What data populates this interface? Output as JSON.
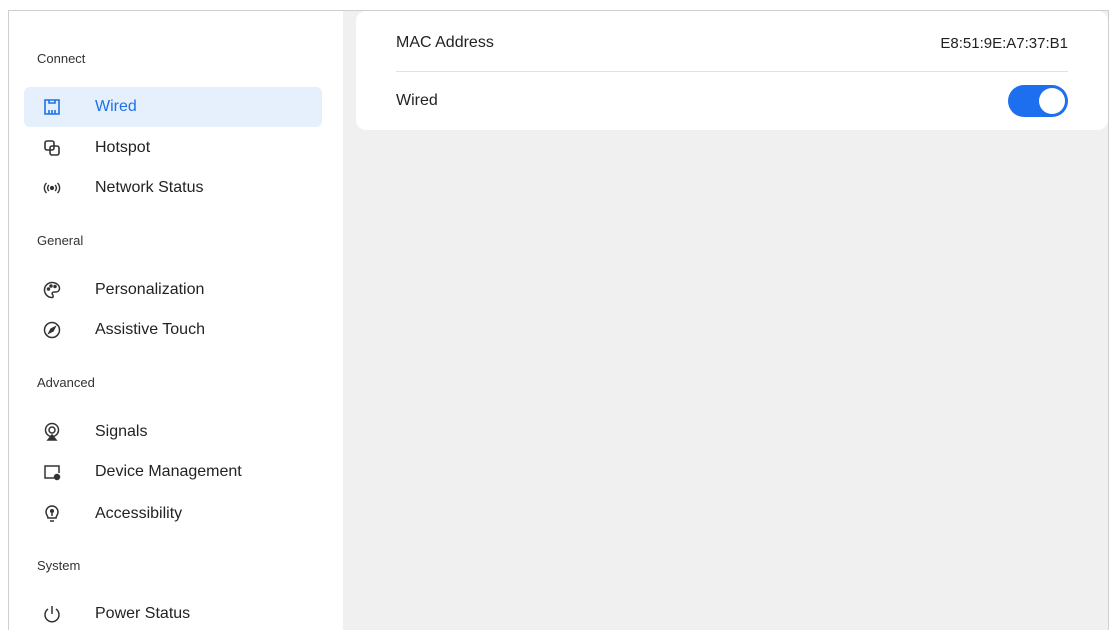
{
  "sidebar": {
    "sections": {
      "connect": "Connect",
      "general": "General",
      "advanced": "Advanced",
      "system": "System"
    },
    "items": [
      {
        "label": "Wired",
        "icon": "ethernet-icon",
        "active": true
      },
      {
        "label": "Hotspot",
        "icon": "hotspot-icon"
      },
      {
        "label": "Network Status",
        "icon": "network-status-icon"
      },
      {
        "label": "Personalization",
        "icon": "palette-icon"
      },
      {
        "label": "Assistive Touch",
        "icon": "compass-icon"
      },
      {
        "label": "Signals",
        "icon": "signals-icon"
      },
      {
        "label": "Device Management",
        "icon": "device-management-icon"
      },
      {
        "label": "Accessibility",
        "icon": "accessibility-icon"
      },
      {
        "label": "Power Status",
        "icon": "power-icon"
      }
    ]
  },
  "main": {
    "mac_label": "MAC Address",
    "mac_value": "E8:51:9E:A7:37:B1",
    "wired_label": "Wired",
    "wired_enabled": true
  },
  "colors": {
    "accent": "#1e6ff0",
    "active_bg": "#e6effc",
    "content_bg": "#f0f0f0"
  }
}
